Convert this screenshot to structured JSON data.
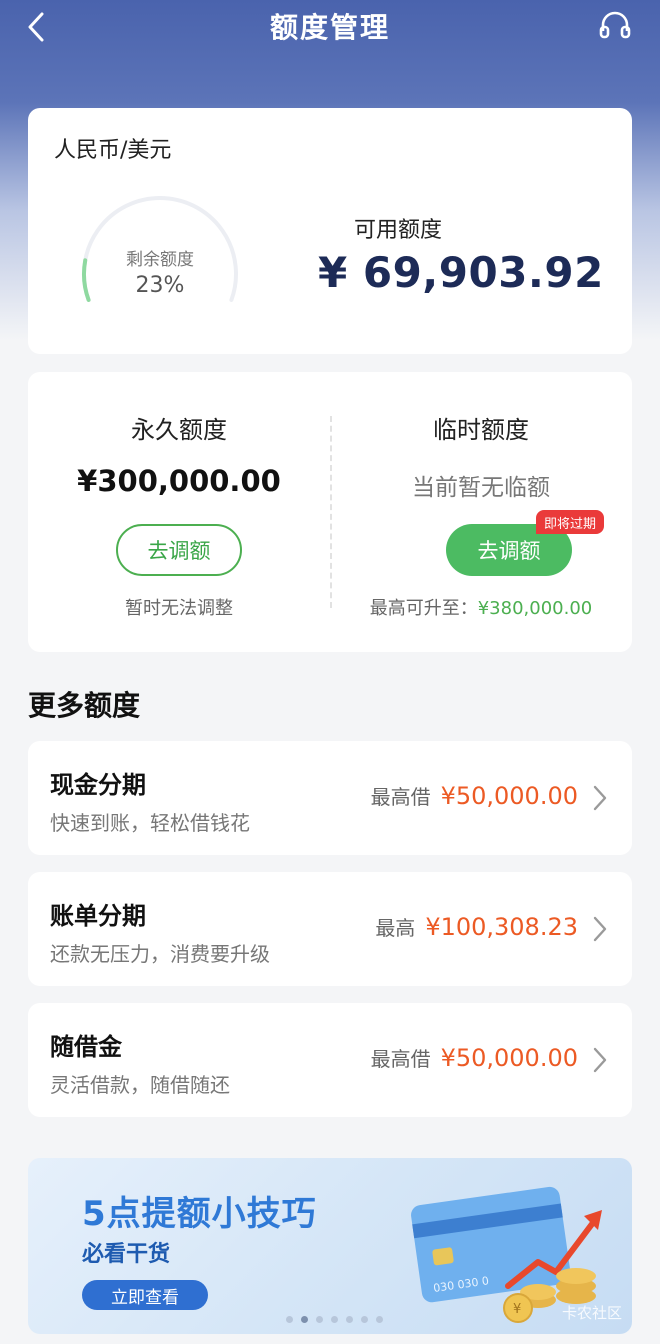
{
  "nav": {
    "title": "额度管理"
  },
  "summary": {
    "currency": "人民币/美元",
    "remaining_label": "剩余额度",
    "remaining_percent": "23%",
    "remaining_fraction": 0.23,
    "available_label": "可用额度",
    "available_amount": "¥ 69,903.92"
  },
  "permanent": {
    "title": "永久额度",
    "amount": "¥300,000.00",
    "button": "去调额",
    "note": "暂时无法调整"
  },
  "temporary": {
    "title": "临时额度",
    "status": "当前暂无临额",
    "button": "去调额",
    "badge": "即将过期",
    "note_prefix": "最高可升至：",
    "note_value": "¥380,000.00"
  },
  "more": {
    "title": "更多额度",
    "items": [
      {
        "title": "现金分期",
        "subtitle": "快速到账，轻松借钱花",
        "prefix": "最高借",
        "amount": "¥50,000.00"
      },
      {
        "title": "账单分期",
        "subtitle": "还款无压力，消费要升级",
        "prefix": "最高",
        "amount": "¥100,308.23"
      },
      {
        "title": "随借金",
        "subtitle": "灵活借款，随借随还",
        "prefix": "最高借",
        "amount": "¥50,000.00"
      }
    ]
  },
  "banner": {
    "title": "5点提额小技巧",
    "subtitle": "必看干货",
    "button": "立即查看",
    "card_number_fragment": "030 030 0",
    "coin_symbol": "¥",
    "watermark": "卡农社区"
  },
  "colors": {
    "header": "#4a63ad",
    "accent_green": "#4cbb62",
    "amount_orange": "#ec5a24",
    "badge_red": "#ea3a3a",
    "amount_navy": "#1d2b57"
  }
}
